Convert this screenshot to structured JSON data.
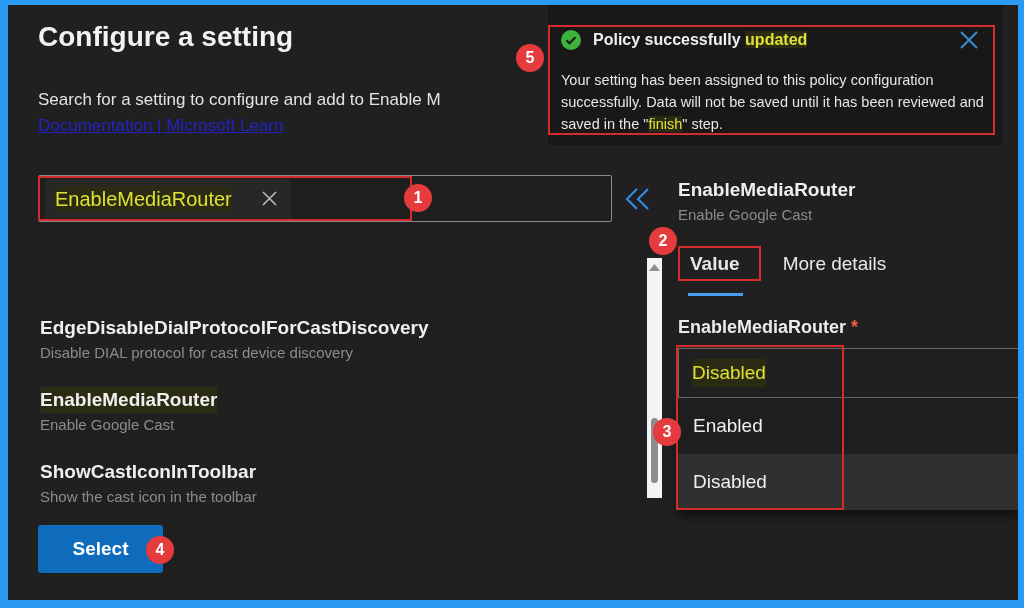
{
  "page": {
    "title": "Configure a setting",
    "description": "Search for a setting to configure and add to Enable M",
    "link": "Documentation | Microsoft Learn"
  },
  "toast": {
    "kind": "success",
    "title_parts": [
      {
        "text": "Policy successfully",
        "highlighted": false
      },
      {
        "text": "updated",
        "highlighted": true
      }
    ],
    "body_parts": [
      {
        "text": "Your setting has been assigned to this policy configuration successfully. Data will not be saved until it has been reviewed and saved in the \"",
        "highlighted": false
      },
      {
        "text": "finish",
        "highlighted": true
      },
      {
        "text": "\" step.",
        "highlighted": false
      }
    ],
    "outlined": true,
    "callout": "5"
  },
  "search": {
    "term": "EnableMediaRouter",
    "highlighted": true,
    "outlined": true,
    "callout": "1"
  },
  "results": [
    {
      "name": "EdgeDisableDialProtocolForCastDiscovery",
      "description": "Disable DIAL protocol for cast device discovery",
      "highlighted": false
    },
    {
      "name": "EnableMediaRouter",
      "description": "Enable Google Cast",
      "highlighted": true
    },
    {
      "name": "ShowCastIconInToolbar",
      "description": "Show the cast icon in the toolbar",
      "highlighted": false
    }
  ],
  "select_button": {
    "label": "Select",
    "callout": "4"
  },
  "detail": {
    "name": "EnableMediaRouter",
    "description": "Enable Google Cast",
    "tabs": [
      {
        "label": "Value",
        "selected": true,
        "outlined": true,
        "callout": "2"
      },
      {
        "label": "More details",
        "selected": false,
        "outlined": false
      }
    ],
    "field": {
      "label": "EnableMediaRouter",
      "required_mark": "*",
      "value": "Disabled",
      "value_highlighted": true,
      "expanded": true,
      "outlined": true,
      "callout": "3",
      "options": [
        {
          "label": "Enabled",
          "hovered": false
        },
        {
          "label": "Disabled",
          "hovered": true
        }
      ]
    }
  }
}
